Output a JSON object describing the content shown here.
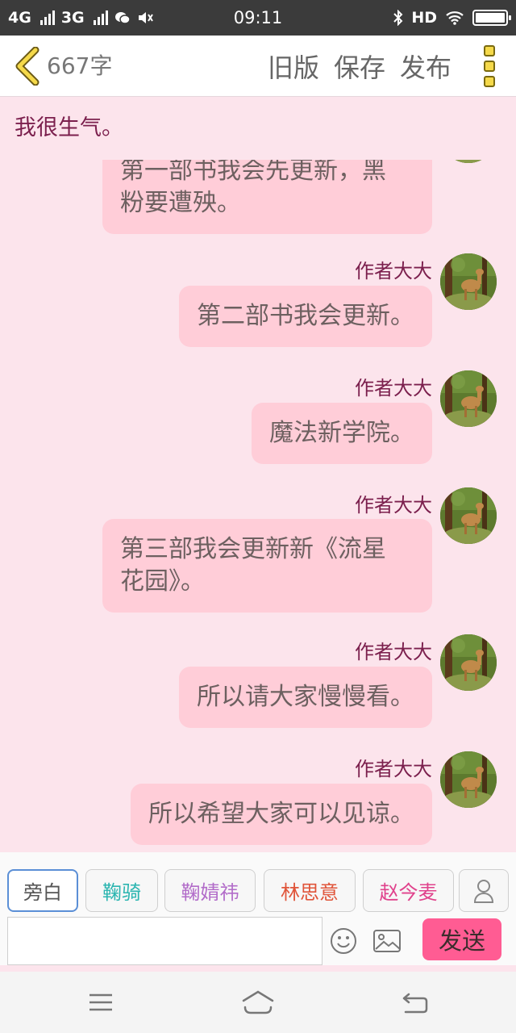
{
  "status_bar": {
    "network_1": "4G",
    "network_2": "3G",
    "time": "09:11",
    "hd": "HD",
    "battery_level": 1.0
  },
  "toolbar": {
    "word_count": "667字",
    "old_version": "旧版",
    "save": "保存",
    "publish": "发布"
  },
  "chat": {
    "pinned_text": "我很生气。",
    "messages": [
      {
        "speaker": "",
        "text_lines": [
          "第一部书我会先更新，黑",
          "粉要遭殃。"
        ]
      },
      {
        "speaker": "作者大大",
        "text_lines": [
          "第二部书我会更新。"
        ]
      },
      {
        "speaker": "作者大大",
        "text_lines": [
          "魔法新学院。"
        ]
      },
      {
        "speaker": "作者大大",
        "text_lines": [
          "第三部我会更新新《流星",
          "花园》。"
        ]
      },
      {
        "speaker": "作者大大",
        "text_lines": [
          "所以请大家慢慢看。"
        ]
      },
      {
        "speaker": "作者大大",
        "text_lines": [
          "所以希望大家可以见谅。"
        ]
      }
    ]
  },
  "characters": [
    {
      "label": "旁白",
      "color": "#555555",
      "active": true
    },
    {
      "label": "鞠骑",
      "color": "#2bb5b0",
      "active": false
    },
    {
      "label": "鞠婧祎",
      "color": "#b26cc9",
      "active": false
    },
    {
      "label": "林思意",
      "color": "#e0553a",
      "active": false
    },
    {
      "label": "赵今麦",
      "color": "#e0428c",
      "active": false
    }
  ],
  "composer": {
    "input_value": "",
    "send_label": "发送"
  },
  "icons": {
    "back": "chevron-left-icon",
    "more": "more-vertical-icon",
    "person": "person-icon",
    "emoji": "emoji-icon",
    "image": "image-icon",
    "nav_menu": "menu-icon",
    "nav_home": "home-icon",
    "nav_back": "back-icon"
  },
  "colors": {
    "accent": "#ff5c93",
    "bubble": "#ffcdd8",
    "background": "#fce4ec",
    "speaker": "#7b1f4d"
  }
}
